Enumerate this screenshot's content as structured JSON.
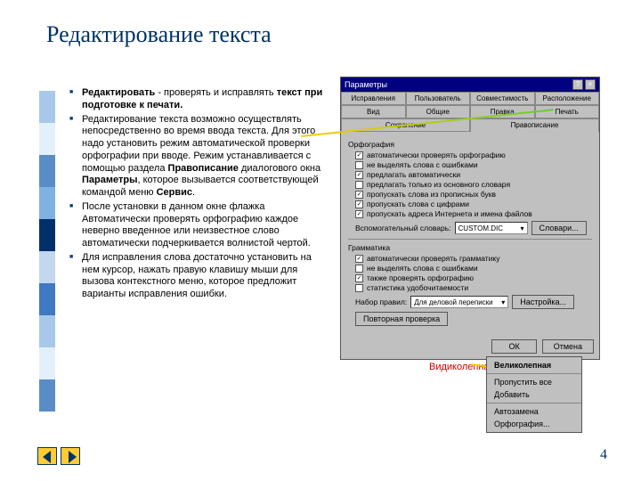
{
  "title": "Редактирование текста",
  "pageNumber": "4",
  "stripeColors": [
    "#a7c8e8",
    "#e2f0fb",
    "#5a8dc7",
    "#7fb2e2",
    "#00306a",
    "#c2d8ef",
    "#3e79c2",
    "#a7c8e8",
    "#e2f0fb",
    "#5a8dc7"
  ],
  "bullets": [
    "<b>Редактировать</b> - проверять и исправлять <b>текст при подготовке к печати.</b>",
    "Редактирование текста возможно осуществлять непосредственно во время ввода текста. Для этого надо установить режим автоматической проверки орфографии при вводе. Режим устанавливается с помощью раздела <b>Правописание</b> диалогового окна <b>Параметры</b>, которое вызывается соответствующей командой меню <b>Сервис</b>.",
    "После установки в данном окне флажка Автоматически проверять орфографию каждое неверно введенное или неизвестное слово автоматически подчеркивается волнистой чертой.",
    "Для исправления слова достаточно установить на нем курсор, нажать правую клавишу мыши для вызова контекстного меню, которое предложит варианты исправления ошибки."
  ],
  "dialog": {
    "title": "Параметры",
    "tabsRow1": [
      "Исправления",
      "Пользователь",
      "Совместимость",
      "Расположение"
    ],
    "tabsRow2": [
      "Вид",
      "Общие",
      "Правка",
      "Печать",
      "Сохранение",
      "Правописание"
    ],
    "group1": "Орфография",
    "checks1": [
      {
        "c": true,
        "t": "автоматически проверять орфографию"
      },
      {
        "c": false,
        "t": "не выделять слова с ошибками"
      },
      {
        "c": true,
        "t": "предлагать автоматически"
      },
      {
        "c": false,
        "t": "предлагать только из основного словаря"
      },
      {
        "c": true,
        "t": "пропускать слова из прописных букв"
      },
      {
        "c": true,
        "t": "пропускать слова с цифрами"
      },
      {
        "c": true,
        "t": "пропускать адреса Интернета и имена файлов"
      }
    ],
    "dictLabel": "Вспомогательный словарь:",
    "dictValue": "CUSTOM.DIC",
    "dictBtn": "Словари...",
    "group2": "Грамматика",
    "checks2": [
      {
        "c": true,
        "t": "автоматически проверять грамматику"
      },
      {
        "c": false,
        "t": "не выделять слова с ошибками"
      },
      {
        "c": true,
        "t": "также проверять орфографию"
      },
      {
        "c": false,
        "t": "статистика удобочитаемости"
      }
    ],
    "styleLabel": "Набор правил:",
    "styleValue": "Для деловой переписки",
    "styleBtn": "Настройка...",
    "recheckBtn": "Повторная проверка",
    "ok": "ОК",
    "cancel": "Отмена"
  },
  "misspelled": "Видиколепная",
  "context": {
    "bold": "Великолепная",
    "ignore": "Пропустить все",
    "add": "Добавить",
    "auto": "Автозамена",
    "spell": "Орфография..."
  }
}
